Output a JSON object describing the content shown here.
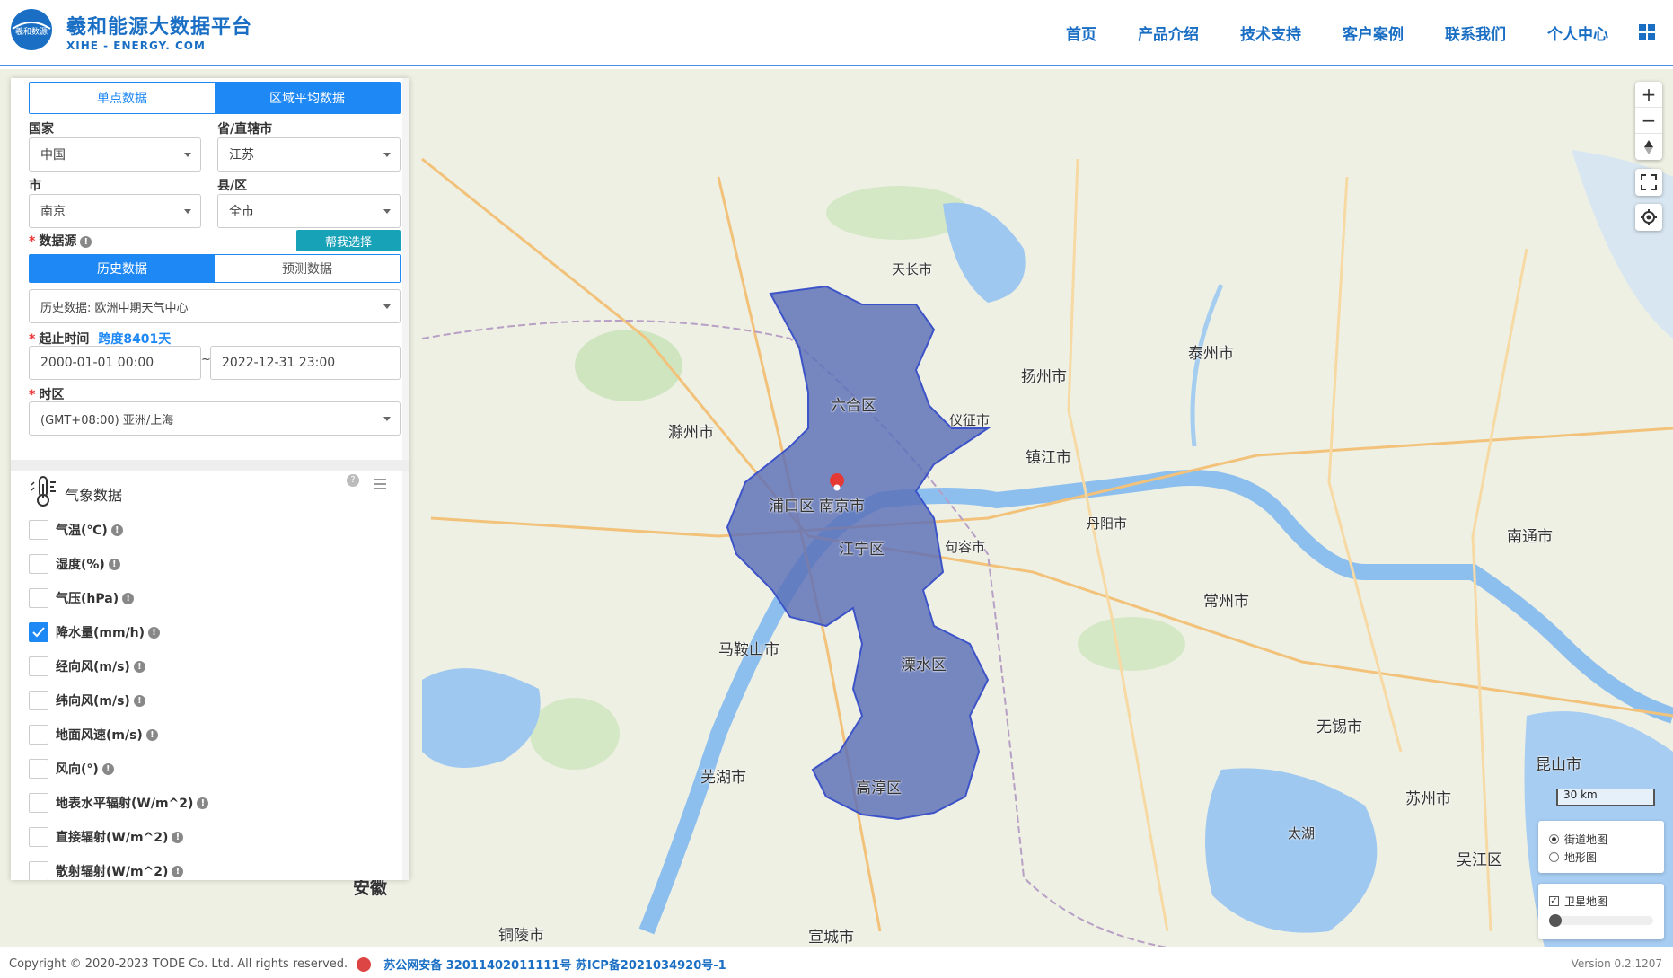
{
  "header": {
    "title": "羲和能源大数据平台",
    "subtitle": "XIHE - ENERGY. COM",
    "logo_text": "羲和数源",
    "nav": [
      "首页",
      "产品介绍",
      "技术支持",
      "客户案例",
      "联系我们",
      "个人中心"
    ]
  },
  "panel": {
    "tabs": {
      "single": "单点数据",
      "region": "区域平均数据",
      "active": "region"
    },
    "country": {
      "label": "国家",
      "value": "中国"
    },
    "province": {
      "label": "省/直辖市",
      "value": "江苏"
    },
    "city": {
      "label": "市",
      "value": "南京"
    },
    "district": {
      "label": "县/区",
      "value": "全市"
    },
    "source": {
      "label": "数据源",
      "help_button": "帮我选择",
      "tab_history": "历史数据",
      "tab_forecast": "预测数据",
      "active": "history",
      "value": "历史数据: 欧洲中期天气中心"
    },
    "time": {
      "label": "起止时间",
      "span": "跨度8401天",
      "start": "2000-01-01 00:00",
      "end": "2022-12-31 23:00",
      "tilde": "~"
    },
    "timezone": {
      "label": "时区",
      "value": "(GMT+08:00) 亚洲/上海"
    },
    "meteo": {
      "title": "气象数据",
      "help": "?",
      "items": [
        {
          "label": "气温(℃)",
          "checked": false
        },
        {
          "label": "湿度(%)",
          "checked": false
        },
        {
          "label": "气压(hPa)",
          "checked": false
        },
        {
          "label": "降水量(mm/h)",
          "checked": true
        },
        {
          "label": "经向风(m/s)",
          "checked": false
        },
        {
          "label": "纬向风(m/s)",
          "checked": false
        },
        {
          "label": "地面风速(m/s)",
          "checked": false
        },
        {
          "label": "风向(°)",
          "checked": false
        },
        {
          "label": "地表水平辐射(W/m^2)",
          "checked": false
        },
        {
          "label": "直接辐射(W/m^2)",
          "checked": false
        },
        {
          "label": "散射辐射(W/m^2)",
          "checked": false
        }
      ]
    }
  },
  "map": {
    "labels": [
      "六合区",
      "浦口区",
      "南京市",
      "江宁区",
      "溧水区",
      "高淳区",
      "镇江市",
      "扬州市",
      "滁州市",
      "马鞍山市",
      "芜湖市",
      "常州市",
      "无锡市",
      "苏州市",
      "泰州市",
      "南通市",
      "句容市",
      "仪征市",
      "天长市",
      "丹阳市",
      "太湖",
      "宣城市",
      "铜陵市",
      "安徽",
      "吴江区",
      "昆山市"
    ],
    "scale": "30 km",
    "layers": {
      "street": "街道地图",
      "terrain": "地形图",
      "satellite": "卫星地图",
      "selected": "street",
      "satellite_on": true
    },
    "region_color": "#5b6fb8"
  },
  "footer": {
    "copyright": "Copyright © 2020-2023 TODE Co. Ltd. All rights reserved.",
    "beian": "苏公网安备 32011402011111号 苏ICP备2021034920号-1",
    "version": "Version 0.2.1207"
  }
}
